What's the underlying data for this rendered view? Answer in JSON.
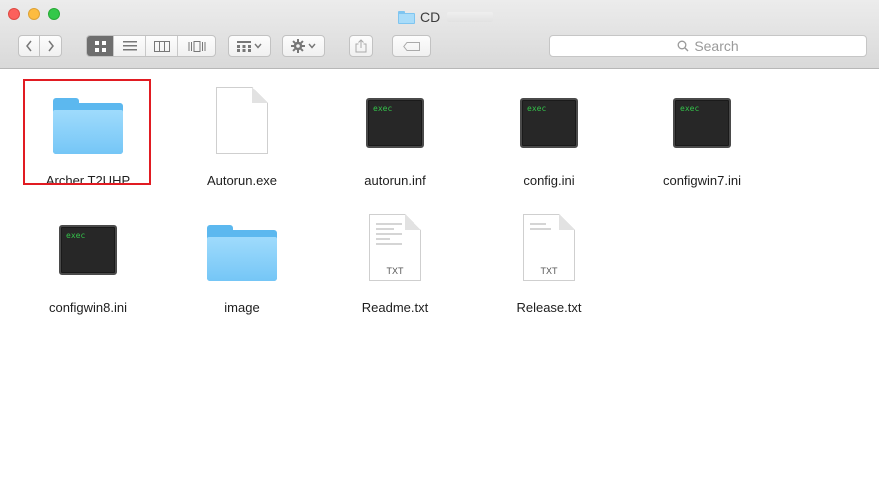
{
  "window": {
    "title": "CD",
    "title_icon": "folder-icon"
  },
  "toolbar": {
    "back_icon": "chevron-left-icon",
    "forward_icon": "chevron-right-icon",
    "view_modes": [
      "icon-view",
      "list-view",
      "column-view",
      "cover-flow-view"
    ],
    "active_view": "icon-view",
    "arrange_icon": "arrange-grid-icon",
    "action_icon": "gear-icon",
    "share_icon": "share-icon",
    "tags_icon": "tag-icon",
    "search_placeholder": "Search"
  },
  "files": [
    {
      "name": "Archer T2UHP",
      "kind": "folder",
      "selected": true
    },
    {
      "name": "Autorun.exe",
      "kind": "document"
    },
    {
      "name": "autorun.inf",
      "kind": "exec",
      "badge": "exec"
    },
    {
      "name": "config.ini",
      "kind": "exec",
      "badge": "exec"
    },
    {
      "name": "configwin7.ini",
      "kind": "exec",
      "badge": "exec"
    },
    {
      "name": "configwin8.ini",
      "kind": "exec",
      "badge": "exec"
    },
    {
      "name": "image",
      "kind": "folder"
    },
    {
      "name": "Readme.txt",
      "kind": "text",
      "ext": "TXT"
    },
    {
      "name": "Release.txt",
      "kind": "text",
      "ext": "TXT"
    }
  ],
  "colors": {
    "selection_outline": "#e11b22",
    "folder": "#75c6f6",
    "exec_text": "#34c14a"
  }
}
